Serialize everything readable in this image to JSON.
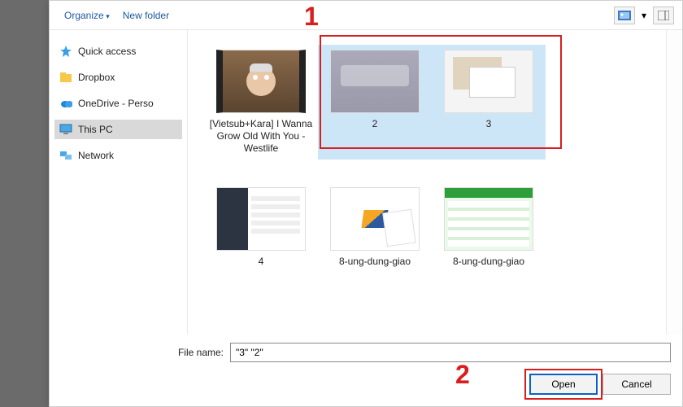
{
  "toolbar": {
    "organize": "Organize",
    "newfolder": "New folder"
  },
  "nav": {
    "items": [
      {
        "label": "Quick access",
        "icon": "star"
      },
      {
        "label": "Dropbox",
        "icon": "dropbox"
      },
      {
        "label": "OneDrive - Perso",
        "icon": "onedrive"
      },
      {
        "label": "This PC",
        "icon": "thispc"
      },
      {
        "label": "Network",
        "icon": "network"
      }
    ]
  },
  "files": [
    {
      "label": "[Vietsub+Kara] I Wanna Grow Old With You - Westlife",
      "kind": "video",
      "selected": false
    },
    {
      "label": "2",
      "kind": "sc1",
      "selected": true
    },
    {
      "label": "3",
      "kind": "sc2",
      "selected": true
    },
    {
      "label": "4",
      "kind": "sc3",
      "selected": false
    },
    {
      "label": "8-ung-dung-giao",
      "kind": "sc4",
      "selected": false
    },
    {
      "label": "8-ung-dung-giao",
      "kind": "sc5",
      "selected": false
    }
  ],
  "filename": {
    "label": "File name:",
    "value": "\"3\" \"2\""
  },
  "buttons": {
    "open": "Open",
    "cancel": "Cancel"
  },
  "callouts": {
    "one": "1",
    "two": "2"
  }
}
